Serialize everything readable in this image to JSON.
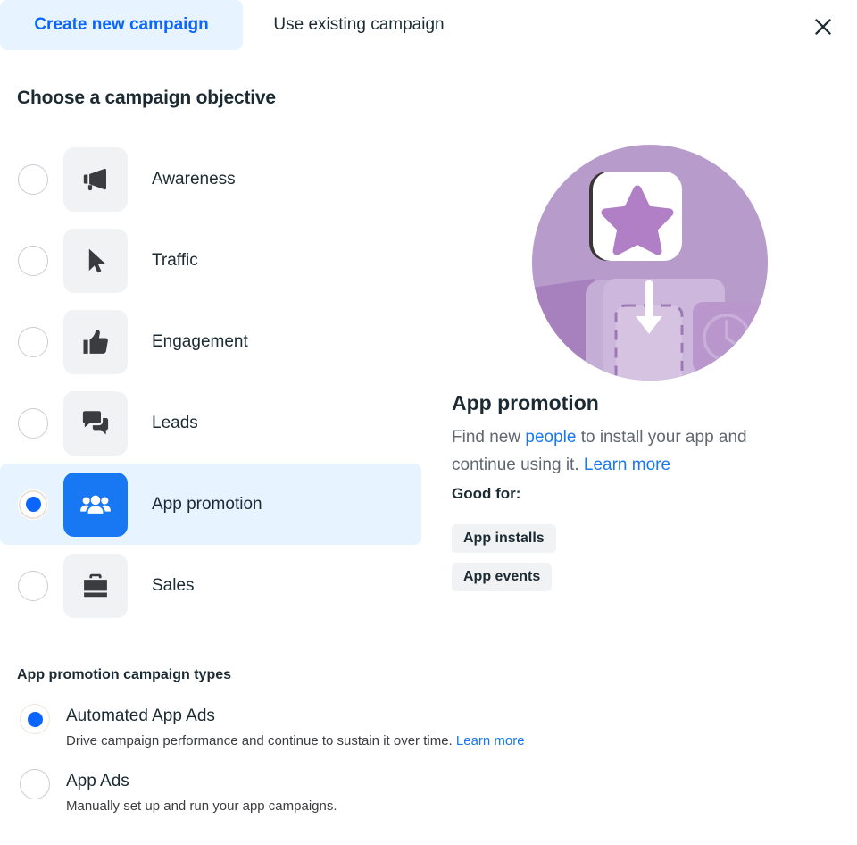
{
  "tabs": [
    {
      "label": "Create new campaign",
      "active": true
    },
    {
      "label": "Use existing campaign",
      "active": false
    }
  ],
  "close_icon": "close-icon",
  "objective_section": {
    "title": "Choose a campaign objective",
    "options": [
      {
        "label": "Awareness",
        "icon": "megaphone-icon",
        "selected": false
      },
      {
        "label": "Traffic",
        "icon": "cursor-icon",
        "selected": false
      },
      {
        "label": "Engagement",
        "icon": "thumbs-up-icon",
        "selected": false
      },
      {
        "label": "Leads",
        "icon": "chat-bubbles-icon",
        "selected": false
      },
      {
        "label": "App promotion",
        "icon": "people-group-icon",
        "selected": true
      },
      {
        "label": "Sales",
        "icon": "briefcase-icon",
        "selected": false
      }
    ]
  },
  "detail": {
    "illustration": "app-install-illustration",
    "title": "App promotion",
    "description_part1": "Find new ",
    "description_link1": "people",
    "description_part2": " to install your app and continue using it. ",
    "description_link2": "Learn more",
    "good_for_label": "Good for:",
    "good_for_pills": [
      "App installs",
      "App events"
    ]
  },
  "campaign_types": {
    "title": "App promotion campaign types",
    "options": [
      {
        "label": "Automated App Ads",
        "sub": "Drive campaign performance and continue to sustain it over time. ",
        "sub_link": "Learn more",
        "selected": true
      },
      {
        "label": "App Ads",
        "sub": "Manually set up and run your app campaigns.",
        "sub_link": "",
        "selected": false
      }
    ]
  },
  "colors": {
    "accent_blue": "#1877f2",
    "link_blue": "#0a66ff",
    "tab_active_bg": "#e7f3ff",
    "row_selected_bg": "#e7f3ff",
    "tile_bg": "#f1f2f3",
    "text_primary": "#1c2b33",
    "text_secondary": "#606770",
    "illustration_purple": "#b79ccb"
  }
}
